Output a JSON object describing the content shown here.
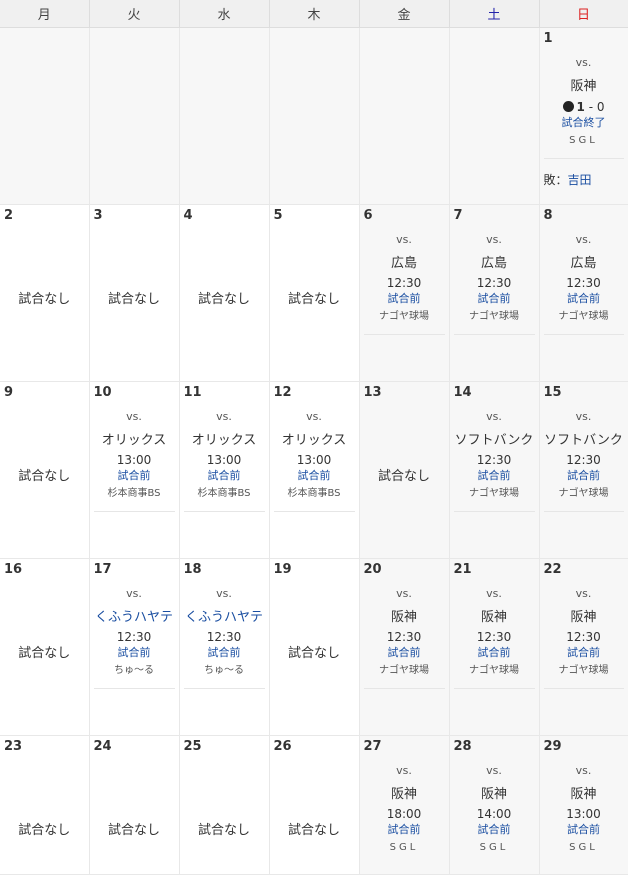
{
  "weekdays": [
    "月",
    "火",
    "水",
    "木",
    "金",
    "土",
    "日"
  ],
  "none_label": "試合なし",
  "vs_label": "vs.",
  "day1": {
    "day": "1",
    "opponent": "阪神",
    "score_home": "1",
    "score_sep": "-",
    "score_away": "0",
    "status": "試合終了",
    "venue": "SGL",
    "loser_label": "敗：",
    "loser_name": "吉田"
  },
  "weeks": [
    [
      {
        "day": "2"
      },
      {
        "day": "3"
      },
      {
        "day": "4"
      },
      {
        "day": "5"
      },
      {
        "day": "6",
        "opponent": "広島",
        "time": "12:30",
        "status": "試合前",
        "venue": "ナゴヤ球場"
      },
      {
        "day": "7",
        "opponent": "広島",
        "time": "12:30",
        "status": "試合前",
        "venue": "ナゴヤ球場"
      },
      {
        "day": "8",
        "opponent": "広島",
        "time": "12:30",
        "status": "試合前",
        "venue": "ナゴヤ球場"
      }
    ],
    [
      {
        "day": "9"
      },
      {
        "day": "10",
        "opponent": "オリックス",
        "time": "13:00",
        "status": "試合前",
        "venue": "杉本商事BS"
      },
      {
        "day": "11",
        "opponent": "オリックス",
        "time": "13:00",
        "status": "試合前",
        "venue": "杉本商事BS"
      },
      {
        "day": "12",
        "opponent": "オリックス",
        "time": "13:00",
        "status": "試合前",
        "venue": "杉本商事BS"
      },
      {
        "day": "13"
      },
      {
        "day": "14",
        "opponent": "ソフトバンク",
        "time": "12:30",
        "status": "試合前",
        "venue": "ナゴヤ球場"
      },
      {
        "day": "15",
        "opponent": "ソフトバンク",
        "time": "12:30",
        "status": "試合前",
        "venue": "ナゴヤ球場"
      }
    ],
    [
      {
        "day": "16"
      },
      {
        "day": "17",
        "opponent": "くふうハヤテ",
        "time": "12:30",
        "status": "試合前",
        "venue": "ちゅ～る"
      },
      {
        "day": "18",
        "opponent": "くふうハヤテ",
        "time": "12:30",
        "status": "試合前",
        "venue": "ちゅ～る"
      },
      {
        "day": "19"
      },
      {
        "day": "20",
        "opponent": "阪神",
        "time": "12:30",
        "status": "試合前",
        "venue": "ナゴヤ球場"
      },
      {
        "day": "21",
        "opponent": "阪神",
        "time": "12:30",
        "status": "試合前",
        "venue": "ナゴヤ球場"
      },
      {
        "day": "22",
        "opponent": "阪神",
        "time": "12:30",
        "status": "試合前",
        "venue": "ナゴヤ球場"
      }
    ],
    [
      {
        "day": "23"
      },
      {
        "day": "24"
      },
      {
        "day": "25"
      },
      {
        "day": "26"
      },
      {
        "day": "27",
        "opponent": "阪神",
        "time": "18:00",
        "status": "試合前",
        "venue": "SGL"
      },
      {
        "day": "28",
        "opponent": "阪神",
        "time": "14:00",
        "status": "試合前",
        "venue": "SGL"
      },
      {
        "day": "29",
        "opponent": "阪神",
        "time": "13:00",
        "status": "試合前",
        "venue": "SGL"
      }
    ]
  ]
}
